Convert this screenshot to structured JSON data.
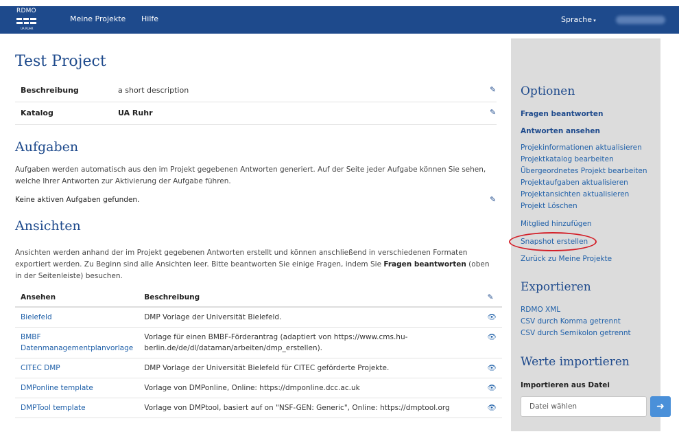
{
  "navbar": {
    "logo_text": "RDMO",
    "logo_sub": "UA RUHR",
    "links": [
      "Meine Projekte",
      "Hilfe"
    ],
    "language": "Sprache"
  },
  "project": {
    "title": "Test Project",
    "description_label": "Beschreibung",
    "description_value": "a short description",
    "catalog_label": "Katalog",
    "catalog_value": "UA Ruhr"
  },
  "tasks": {
    "heading": "Aufgaben",
    "text": "Aufgaben werden automatisch aus den im Projekt gegebenen Antworten generiert. Auf der Seite jeder Aufgabe können Sie sehen, welche Ihrer Antworten zur Aktivierung der Aufgabe führen.",
    "empty": "Keine aktiven Aufgaben gefunden."
  },
  "views": {
    "heading": "Ansichten",
    "text_before": "Ansichten werden anhand der im Projekt gegebenen Antworten erstellt und können anschließend in verschiedenen Formaten exportiert werden. Zu Beginn sind alle Ansichten leer. Bitte beantworten Sie einige Fragen, indem Sie ",
    "text_bold": "Fragen beantworten",
    "text_after": " (oben in der Seitenleiste) besuchen.",
    "col_view": "Ansehen",
    "col_desc": "Beschreibung",
    "rows": [
      {
        "name": "Bielefeld",
        "desc": "DMP Vorlage der Universität Bielefeld."
      },
      {
        "name": "BMBF Datenmanagementplanvorlage",
        "desc": "Vorlage für einen BMBF-Förderantrag (adaptiert von https://www.cms.hu-berlin.de/de/dl/dataman/arbeiten/dmp_erstellen)."
      },
      {
        "name": "CITEC DMP",
        "desc": "DMP Vorlage der Universität Bielefeld für CITEC geförderte Projekte."
      },
      {
        "name": "DMPonline template",
        "desc": "Vorlage von DMPonline, Online: https://dmponline.dcc.ac.uk"
      },
      {
        "name": "DMPTool template",
        "desc": "Vorlage von DMPtool, basiert auf on \"NSF-GEN: Generic\", Online: https://dmptool.org"
      }
    ]
  },
  "sidebar": {
    "options_heading": "Optionen",
    "answer": "Fragen beantworten",
    "view_answers": "Antworten ansehen",
    "project_links": [
      "Projekinformationen aktualisieren",
      "Projektkatalog bearbeiten",
      "Übergeordnetes Projekt bearbeiten",
      "Projektaufgaben aktualisieren",
      "Projektansichten aktualisieren",
      "Projekt Löschen"
    ],
    "add_member": "Mitglied hinzufügen",
    "snapshot": "Snapshot erstellen",
    "back": "Zurück zu Meine Projekte",
    "export_heading": "Exportieren",
    "export_links": [
      "RDMO XML",
      "CSV durch Komma getrennt",
      "CSV durch Semikolon getrennt"
    ],
    "import_heading": "Werte importieren",
    "import_label": "Importieren aus Datei",
    "file_placeholder": "Datei wählen"
  }
}
